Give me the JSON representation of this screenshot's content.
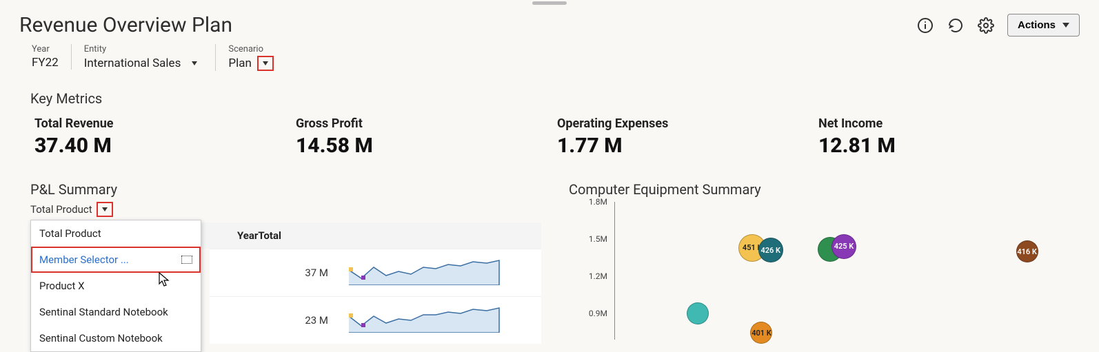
{
  "drag_handle": true,
  "header": {
    "title": "Revenue Overview Plan",
    "actions_label": "Actions"
  },
  "filters": {
    "year": {
      "label": "Year",
      "value": "FY22"
    },
    "entity": {
      "label": "Entity",
      "value": "International Sales"
    },
    "scenario": {
      "label": "Scenario",
      "value": "Plan"
    }
  },
  "key_metrics": {
    "title": "Key Metrics",
    "items": [
      {
        "label": "Total Revenue",
        "value": "37.40 M"
      },
      {
        "label": "Gross Profit",
        "value": "14.58 M"
      },
      {
        "label": "Operating Expenses",
        "value": "1.77 M"
      },
      {
        "label": "Net Income",
        "value": "12.81 M"
      }
    ]
  },
  "pnl": {
    "title": "P&L Summary",
    "product_label": "Total Product",
    "col_header": "YearTotal",
    "rows": [
      {
        "value": "37 M"
      },
      {
        "value": "23 M"
      }
    ],
    "dropdown": {
      "items": [
        {
          "label": "Total Product"
        },
        {
          "label": "Member Selector ...",
          "highlighted": true
        },
        {
          "label": "Product X"
        },
        {
          "label": "Sentinal Standard Notebook"
        },
        {
          "label": "Sentinal Custom Notebook"
        }
      ]
    }
  },
  "equipment": {
    "title": "Computer Equipment Summary",
    "y_ticks": [
      "1.8M",
      "1.5M",
      "1.2M",
      "0.9M"
    ],
    "bubbles": [
      {
        "label": "",
        "x_pct": 18,
        "y_val": 1.0,
        "r": 16,
        "color": "#3fb9b1"
      },
      {
        "label": "451 K",
        "x_pct": 30,
        "y_val": 1.5,
        "r": 20,
        "color": "#f3c250"
      },
      {
        "label": "426 K",
        "x_pct": 34,
        "y_val": 1.48,
        "r": 18,
        "color": "#1f6d78"
      },
      {
        "label": "401 K",
        "x_pct": 32,
        "y_val": 0.85,
        "r": 16,
        "color": "#e38b22"
      },
      {
        "label": "",
        "x_pct": 47,
        "y_val": 1.49,
        "r": 18,
        "color": "#2f8f4e"
      },
      {
        "label": "425 K",
        "x_pct": 50,
        "y_val": 1.51,
        "r": 18,
        "color": "#8838b5"
      },
      {
        "label": "416 K",
        "x_pct": 90,
        "y_val": 1.47,
        "r": 16,
        "color": "#8d4a21"
      }
    ]
  },
  "chart_data": {
    "type": "bubble",
    "title": "Computer Equipment Summary",
    "ylabel": "",
    "ylim": [
      0.9,
      1.8
    ],
    "y_ticks": [
      0.9,
      1.2,
      1.5,
      1.8
    ],
    "series": [
      {
        "name": "bubble-1",
        "y": 1.0,
        "label": "",
        "color": "#3fb9b1"
      },
      {
        "name": "bubble-2",
        "y": 1.5,
        "label": "451 K",
        "color": "#f3c250"
      },
      {
        "name": "bubble-3",
        "y": 1.48,
        "label": "426 K",
        "color": "#1f6d78"
      },
      {
        "name": "bubble-4",
        "y": 0.85,
        "label": "401 K",
        "color": "#e38b22"
      },
      {
        "name": "bubble-5",
        "y": 1.49,
        "label": "",
        "color": "#2f8f4e"
      },
      {
        "name": "bubble-6",
        "y": 1.51,
        "label": "425 K",
        "color": "#8838b5"
      },
      {
        "name": "bubble-7",
        "y": 1.47,
        "label": "416 K",
        "color": "#8d4a21"
      }
    ]
  }
}
